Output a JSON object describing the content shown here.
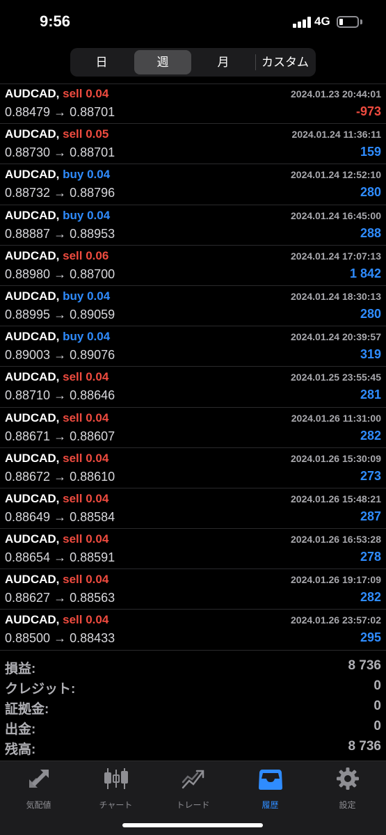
{
  "status_bar": {
    "time": "9:56",
    "network": "4G"
  },
  "period_tabs": [
    {
      "label": "日",
      "active": false
    },
    {
      "label": "週",
      "active": true
    },
    {
      "label": "月",
      "active": false
    },
    {
      "label": "カスタム",
      "active": false
    }
  ],
  "trades": [
    {
      "symbol": "AUDCAD,",
      "side": "sell 0.04",
      "direction": "sell",
      "open": "0.88479",
      "arrow": "→",
      "close": "0.88701",
      "time": "2024.01.23 20:44:01",
      "profit": "-973",
      "profit_sign": "neg"
    },
    {
      "symbol": "AUDCAD,",
      "side": "sell 0.05",
      "direction": "sell",
      "open": "0.88730",
      "arrow": "→",
      "close": "0.88701",
      "time": "2024.01.24 11:36:11",
      "profit": "159",
      "profit_sign": "pos"
    },
    {
      "symbol": "AUDCAD,",
      "side": "buy 0.04",
      "direction": "buy",
      "open": "0.88732",
      "arrow": "→",
      "close": "0.88796",
      "time": "2024.01.24 12:52:10",
      "profit": "280",
      "profit_sign": "pos"
    },
    {
      "symbol": "AUDCAD,",
      "side": "buy 0.04",
      "direction": "buy",
      "open": "0.88887",
      "arrow": "→",
      "close": "0.88953",
      "time": "2024.01.24 16:45:00",
      "profit": "288",
      "profit_sign": "pos"
    },
    {
      "symbol": "AUDCAD,",
      "side": "sell 0.06",
      "direction": "sell",
      "open": "0.88980",
      "arrow": "→",
      "close": "0.88700",
      "time": "2024.01.24 17:07:13",
      "profit": "1 842",
      "profit_sign": "pos"
    },
    {
      "symbol": "AUDCAD,",
      "side": "buy 0.04",
      "direction": "buy",
      "open": "0.88995",
      "arrow": "→",
      "close": "0.89059",
      "time": "2024.01.24 18:30:13",
      "profit": "280",
      "profit_sign": "pos"
    },
    {
      "symbol": "AUDCAD,",
      "side": "buy 0.04",
      "direction": "buy",
      "open": "0.89003",
      "arrow": "→",
      "close": "0.89076",
      "time": "2024.01.24 20:39:57",
      "profit": "319",
      "profit_sign": "pos"
    },
    {
      "symbol": "AUDCAD,",
      "side": "sell 0.04",
      "direction": "sell",
      "open": "0.88710",
      "arrow": "→",
      "close": "0.88646",
      "time": "2024.01.25 23:55:45",
      "profit": "281",
      "profit_sign": "pos"
    },
    {
      "symbol": "AUDCAD,",
      "side": "sell 0.04",
      "direction": "sell",
      "open": "0.88671",
      "arrow": "→",
      "close": "0.88607",
      "time": "2024.01.26 11:31:00",
      "profit": "282",
      "profit_sign": "pos"
    },
    {
      "symbol": "AUDCAD,",
      "side": "sell 0.04",
      "direction": "sell",
      "open": "0.88672",
      "arrow": "→",
      "close": "0.88610",
      "time": "2024.01.26 15:30:09",
      "profit": "273",
      "profit_sign": "pos"
    },
    {
      "symbol": "AUDCAD,",
      "side": "sell 0.04",
      "direction": "sell",
      "open": "0.88649",
      "arrow": "→",
      "close": "0.88584",
      "time": "2024.01.26 15:48:21",
      "profit": "287",
      "profit_sign": "pos"
    },
    {
      "symbol": "AUDCAD,",
      "side": "sell 0.04",
      "direction": "sell",
      "open": "0.88654",
      "arrow": "→",
      "close": "0.88591",
      "time": "2024.01.26 16:53:28",
      "profit": "278",
      "profit_sign": "pos"
    },
    {
      "symbol": "AUDCAD,",
      "side": "sell 0.04",
      "direction": "sell",
      "open": "0.88627",
      "arrow": "→",
      "close": "0.88563",
      "time": "2024.01.26 19:17:09",
      "profit": "282",
      "profit_sign": "pos"
    },
    {
      "symbol": "AUDCAD,",
      "side": "sell 0.04",
      "direction": "sell",
      "open": "0.88500",
      "arrow": "→",
      "close": "0.88433",
      "time": "2024.01.26 23:57:02",
      "profit": "295",
      "profit_sign": "pos"
    }
  ],
  "summary": [
    {
      "label": "損益:",
      "value": "8 736"
    },
    {
      "label": "クレジット:",
      "value": "0"
    },
    {
      "label": "証拠金:",
      "value": "0"
    },
    {
      "label": "出金:",
      "value": "0"
    },
    {
      "label": "残高:",
      "value": "8 736"
    }
  ],
  "tab_bar": [
    {
      "label": "気配値",
      "icon": "quotes-arrows-icon",
      "active": false
    },
    {
      "label": "チャート",
      "icon": "candlestick-chart-icon",
      "active": false
    },
    {
      "label": "トレード",
      "icon": "trade-trend-icon",
      "active": false
    },
    {
      "label": "履歴",
      "icon": "history-tray-icon",
      "active": true
    },
    {
      "label": "設定",
      "icon": "gear-icon",
      "active": false
    }
  ],
  "colors": {
    "sell": "#ef4b3f",
    "buy": "#2f8cff",
    "active_tab": "#2f8cff",
    "inactive_tab": "#8e8e93",
    "background": "#000000"
  }
}
